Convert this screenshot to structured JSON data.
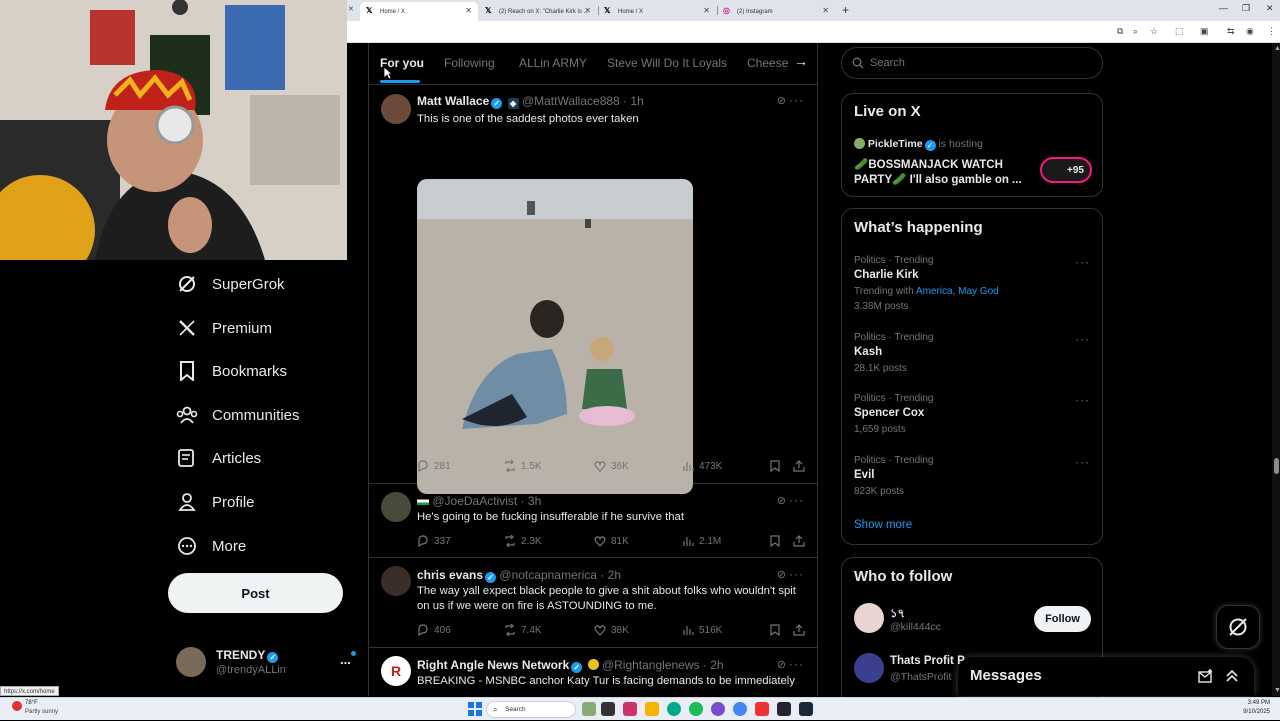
{
  "browser": {
    "tabs": [
      {
        "icon": "x-logo-icon",
        "title": "Home / X",
        "active": true
      },
      {
        "icon": "x-logo-icon",
        "title": "(2) Reach on X: \"Charlie Kirk is ...",
        "active": false
      },
      {
        "icon": "x-logo-icon",
        "title": "Home / X",
        "active": false
      },
      {
        "icon": "instagram-icon",
        "title": "(2) Instagram",
        "active": false
      }
    ],
    "new_tab": "+",
    "status_url": "https://x.com/home"
  },
  "sidebar": {
    "items": [
      {
        "label": "SuperGrok",
        "icon": "grok-icon"
      },
      {
        "label": "Premium",
        "icon": "x-logo-icon"
      },
      {
        "label": "Bookmarks",
        "icon": "bookmark-icon"
      },
      {
        "label": "Communities",
        "icon": "communities-icon"
      },
      {
        "label": "Articles",
        "icon": "articles-icon"
      },
      {
        "label": "Profile",
        "icon": "profile-icon"
      },
      {
        "label": "More",
        "icon": "more-circle-icon"
      }
    ],
    "post_label": "Post",
    "account": {
      "name": "TRENDY",
      "handle": "@trendyALLin",
      "more": "..."
    }
  },
  "feed": {
    "tabs": [
      "For you",
      "Following",
      "ALLin ARMY",
      "Steve Will Do It Loyals",
      "Cheese"
    ],
    "tweets": [
      {
        "name": "Matt Wallace",
        "handle": "@MattWallace888",
        "time": "· 1h",
        "text": "This is one of the saddest photos ever taken",
        "replies": "281",
        "reposts": "1.5K",
        "likes": "36K",
        "views": "473K"
      },
      {
        "name": "",
        "handle": "@JoeDaActivist",
        "time": "· 3h",
        "text": "He's going to be fucking insufferable if he survive that",
        "replies": "337",
        "reposts": "2.3K",
        "likes": "81K",
        "views": "2.1M"
      },
      {
        "name": "chris evans",
        "handle": "@notcapnamerica",
        "time": "· 2h",
        "text": "The way yall expect black people to give a shit about folks who wouldn't spit on us if we were on fire is ASTOUNDING to me.",
        "replies": "406",
        "reposts": "7.4K",
        "likes": "38K",
        "views": "516K"
      },
      {
        "name": "Right Angle News Network",
        "handle": "@Rightanglenews",
        "time": "· 2h",
        "text": "BREAKING - MSNBC anchor Katy Tur is facing demands to be immediately"
      }
    ]
  },
  "right": {
    "search_placeholder": "Search",
    "live": {
      "title": "Live on X",
      "host": "PickleTime",
      "host_suffix": "is hosting",
      "stream_title": "🥒BOSSMANJACK WATCH PARTY🥒 I'll also gamble on ...",
      "viewers": "+95"
    },
    "happening": {
      "title": "What’s happening",
      "trends": [
        {
          "category": "Politics · Trending",
          "name": "Charlie Kirk",
          "with_prefix": "Trending with",
          "with": "America, May God",
          "count": "3.38M posts"
        },
        {
          "category": "Politics · Trending",
          "name": "Kash",
          "count": "28.1K posts"
        },
        {
          "category": "Politics · Trending",
          "name": "Spencer Cox",
          "count": "1,659 posts"
        },
        {
          "category": "Politics · Trending",
          "name": "Evil",
          "count": "823K posts"
        }
      ],
      "show_more": "Show more"
    },
    "who_to_follow": {
      "title": "Who to follow",
      "accounts": [
        {
          "name": "১৭",
          "handle": "@kill444cc",
          "button": "Follow"
        },
        {
          "name": "Thats Profit P",
          "handle": "@ThatsProfit"
        }
      ]
    },
    "messages_label": "Messages"
  },
  "taskbar": {
    "weather_temp": "78°F",
    "weather_desc": "Partly sunny",
    "search": "Search",
    "time": "3:49 PM",
    "date": "9/10/2025"
  },
  "colors": {
    "accent": "#1d9bf0",
    "bg": "#000000",
    "border": "#2f3336",
    "muted": "#71767b"
  }
}
